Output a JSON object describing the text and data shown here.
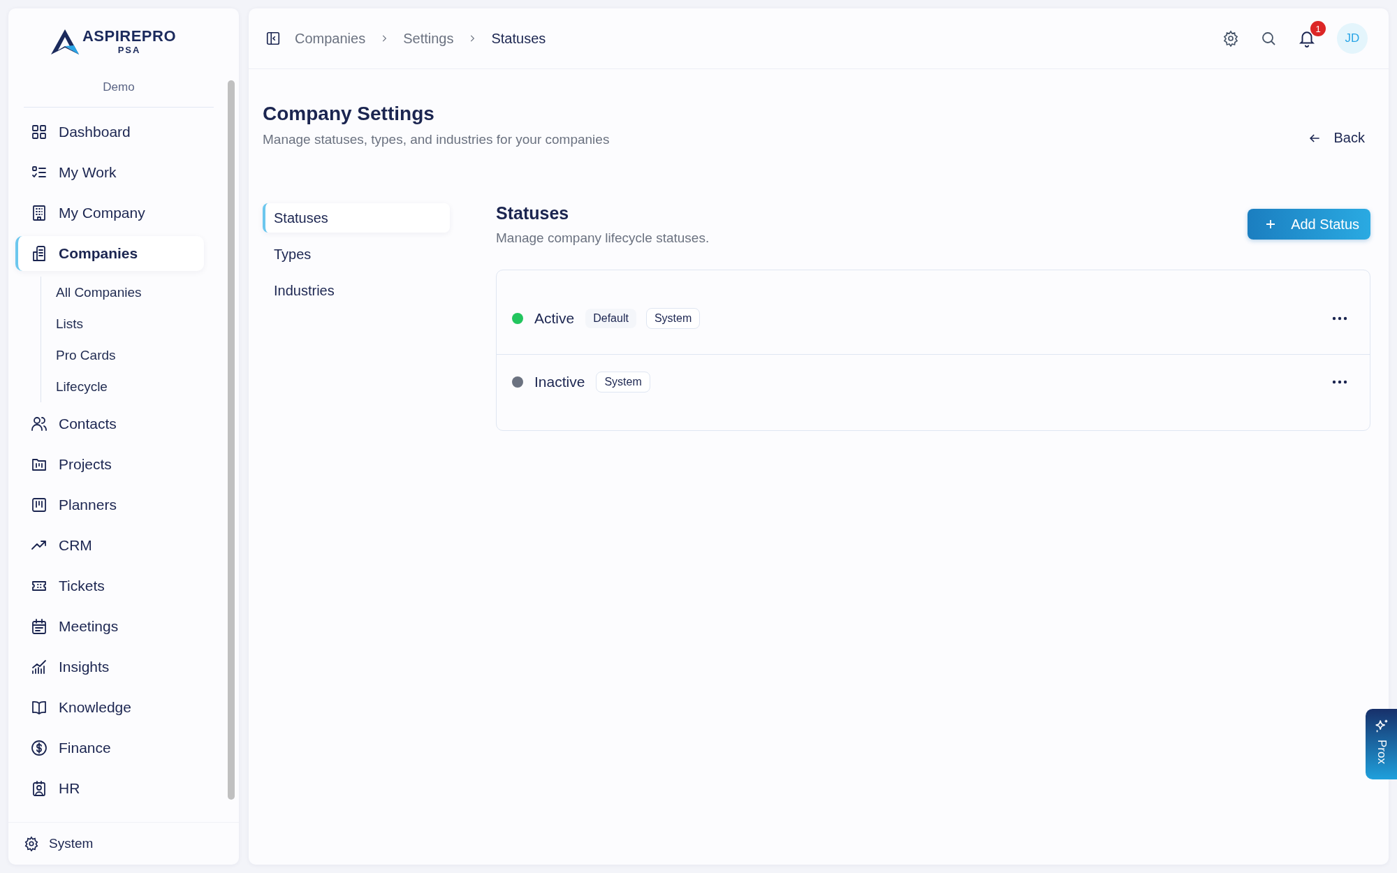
{
  "logo": {
    "name": "ASPIREPRO",
    "sub": "PSA"
  },
  "workspace": "Demo",
  "sidebar": {
    "items": [
      {
        "label": "Dashboard",
        "selected": false
      },
      {
        "label": "My Work",
        "selected": false
      },
      {
        "label": "My Company",
        "selected": false
      },
      {
        "label": "Companies",
        "selected": true,
        "children": [
          {
            "label": "All Companies"
          },
          {
            "label": "Lists"
          },
          {
            "label": "Pro Cards"
          },
          {
            "label": "Lifecycle"
          }
        ]
      },
      {
        "label": "Contacts",
        "selected": false
      },
      {
        "label": "Projects",
        "selected": false
      },
      {
        "label": "Planners",
        "selected": false
      },
      {
        "label": "CRM",
        "selected": false
      },
      {
        "label": "Tickets",
        "selected": false
      },
      {
        "label": "Meetings",
        "selected": false
      },
      {
        "label": "Insights",
        "selected": false
      },
      {
        "label": "Knowledge",
        "selected": false
      },
      {
        "label": "Finance",
        "selected": false
      },
      {
        "label": "HR",
        "selected": false
      }
    ],
    "footer": "System"
  },
  "breadcrumb": [
    "Companies",
    "Settings",
    "Statuses"
  ],
  "notifications": {
    "count": "1"
  },
  "avatar": "JD",
  "page": {
    "title": "Company Settings",
    "subtitle": "Manage statuses, types, and industries for your companies",
    "back": "Back"
  },
  "settings_nav": [
    {
      "label": "Statuses",
      "selected": true
    },
    {
      "label": "Types",
      "selected": false
    },
    {
      "label": "Industries",
      "selected": false
    }
  ],
  "section": {
    "title": "Statuses",
    "subtitle": "Manage company lifecycle statuses.",
    "add_button": "Add Status"
  },
  "statuses": [
    {
      "name": "Active",
      "color": "#22c55e",
      "badges": [
        {
          "label": "Default",
          "kind": "filled"
        },
        {
          "label": "System",
          "kind": "outline"
        }
      ]
    },
    {
      "name": "Inactive",
      "color": "#6b7280",
      "badges": [
        {
          "label": "System",
          "kind": "outline"
        }
      ]
    }
  ],
  "assistant_tab": "Prox"
}
